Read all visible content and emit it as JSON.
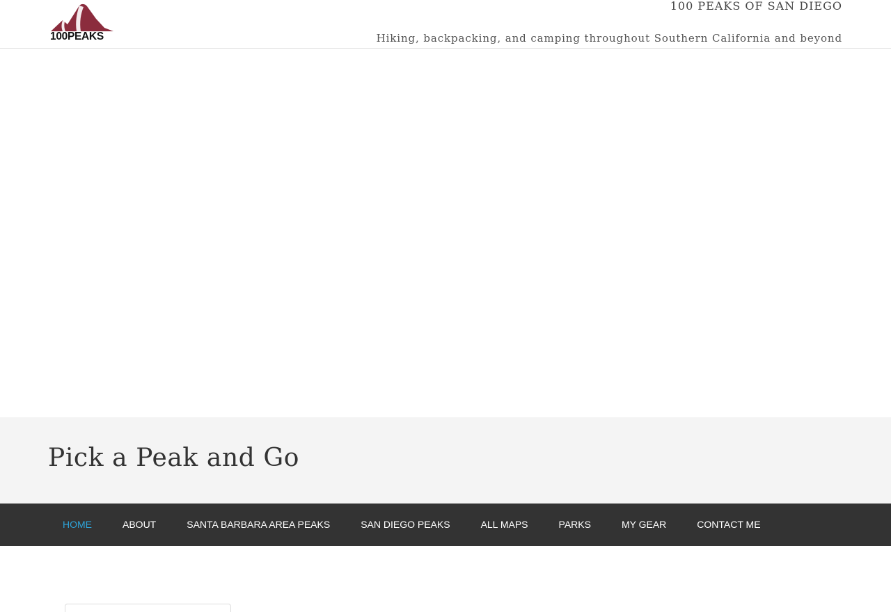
{
  "header": {
    "logo_text": "100PEAKS",
    "site_title": "100 PEAKS OF SAN DIEGO",
    "tagline": "Hiking, backpacking, and camping throughout Southern California and beyond"
  },
  "banner": {
    "title": "Pick a Peak and Go"
  },
  "nav": {
    "items": [
      {
        "label": "HOME",
        "current": true
      },
      {
        "label": "ABOUT"
      },
      {
        "label": "SANTA BARBARA AREA PEAKS"
      },
      {
        "label": "SAN DIEGO PEAKS"
      },
      {
        "label": "ALL MAPS"
      },
      {
        "label": "PARKS"
      },
      {
        "label": "MY GEAR"
      },
      {
        "label": "CONTACT ME"
      }
    ]
  },
  "colors": {
    "logo_mountain": "#8b2c3d",
    "nav_background": "#333333",
    "nav_current": "#2ea3d8",
    "banner_background": "#f4f4f4"
  }
}
